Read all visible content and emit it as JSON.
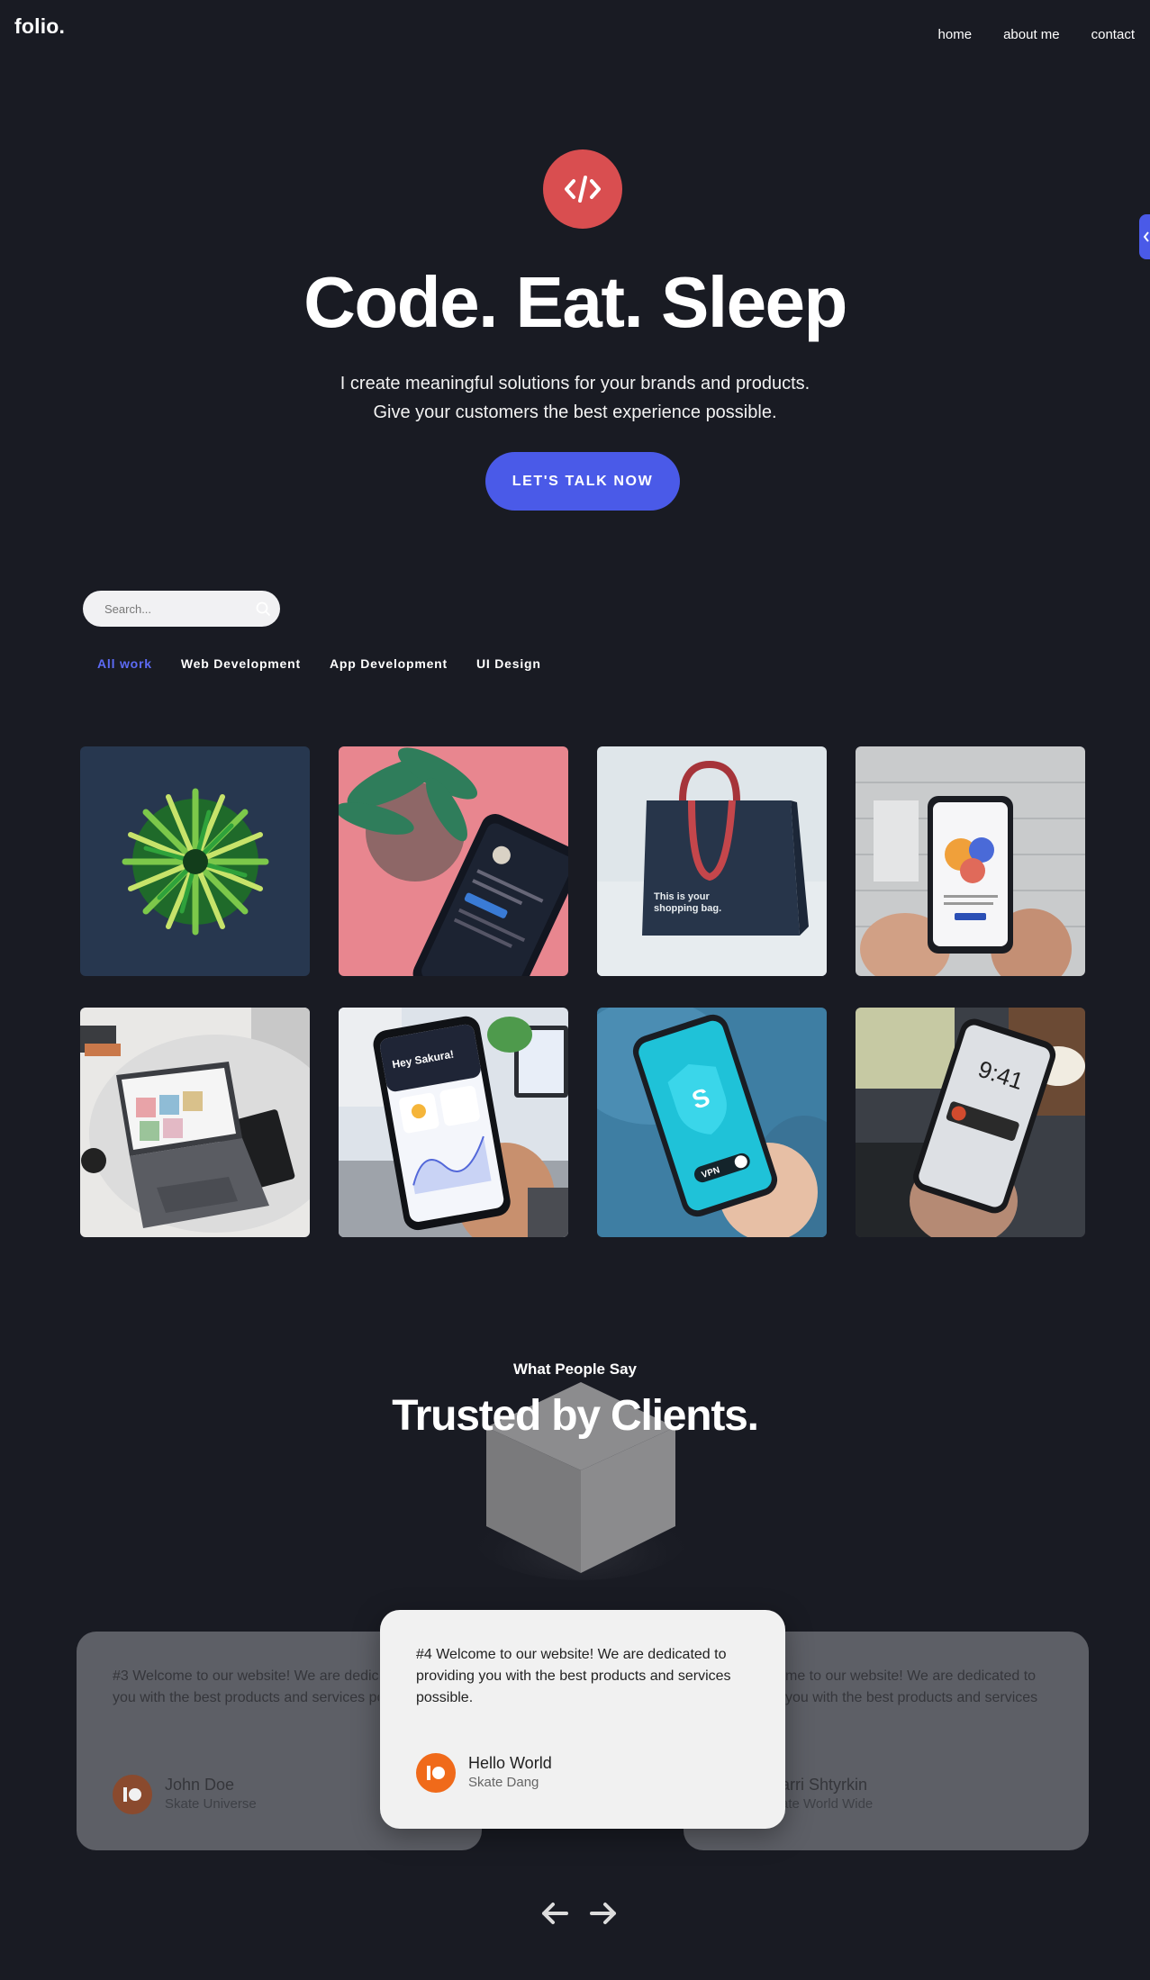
{
  "header": {
    "logo": "folio.",
    "nav": [
      "home",
      "about me",
      "contact"
    ]
  },
  "hero": {
    "icon": "code-icon",
    "title": "Code. Eat. Sleep",
    "subtitle_line1": "I create meaningful solutions for your brands and products.",
    "subtitle_line2": "Give your customers the best experience possible.",
    "cta_label": "LET'S TALK NOW"
  },
  "portfolio": {
    "search_placeholder": "Search...",
    "filters": [
      "All work",
      "Web Development",
      "App Development",
      "UI Design"
    ],
    "active_filter": "All work",
    "bag_text_line1": "This is your",
    "bag_text_line2": "shopping bag.",
    "phone_greeting": "Hey Sakura!",
    "lock_time": "9:41",
    "vpn_label": "VPN"
  },
  "testimonials": {
    "eyebrow": "What People Say",
    "title": "Trusted by Clients.",
    "cards": [
      {
        "quote": "#3 Welcome to our website! We are dedicated to providing you with the best products and services possible.",
        "name": "John Doe",
        "company": "Skate Universe"
      },
      {
        "quote": "#4 Welcome to our website! We are dedicated to providing you with the best products and services possible.",
        "name": "Hello World",
        "company": "Skate Dang"
      },
      {
        "quote": "me to our website! We are dedicated to you with the best products and services",
        "name": "arri Shtyrkin",
        "company": "ate World Wide"
      }
    ]
  },
  "colors": {
    "background": "#191b23",
    "accent": "#4a5ae8",
    "hero_icon": "#d94e50",
    "avatar": "#f06a1a"
  }
}
